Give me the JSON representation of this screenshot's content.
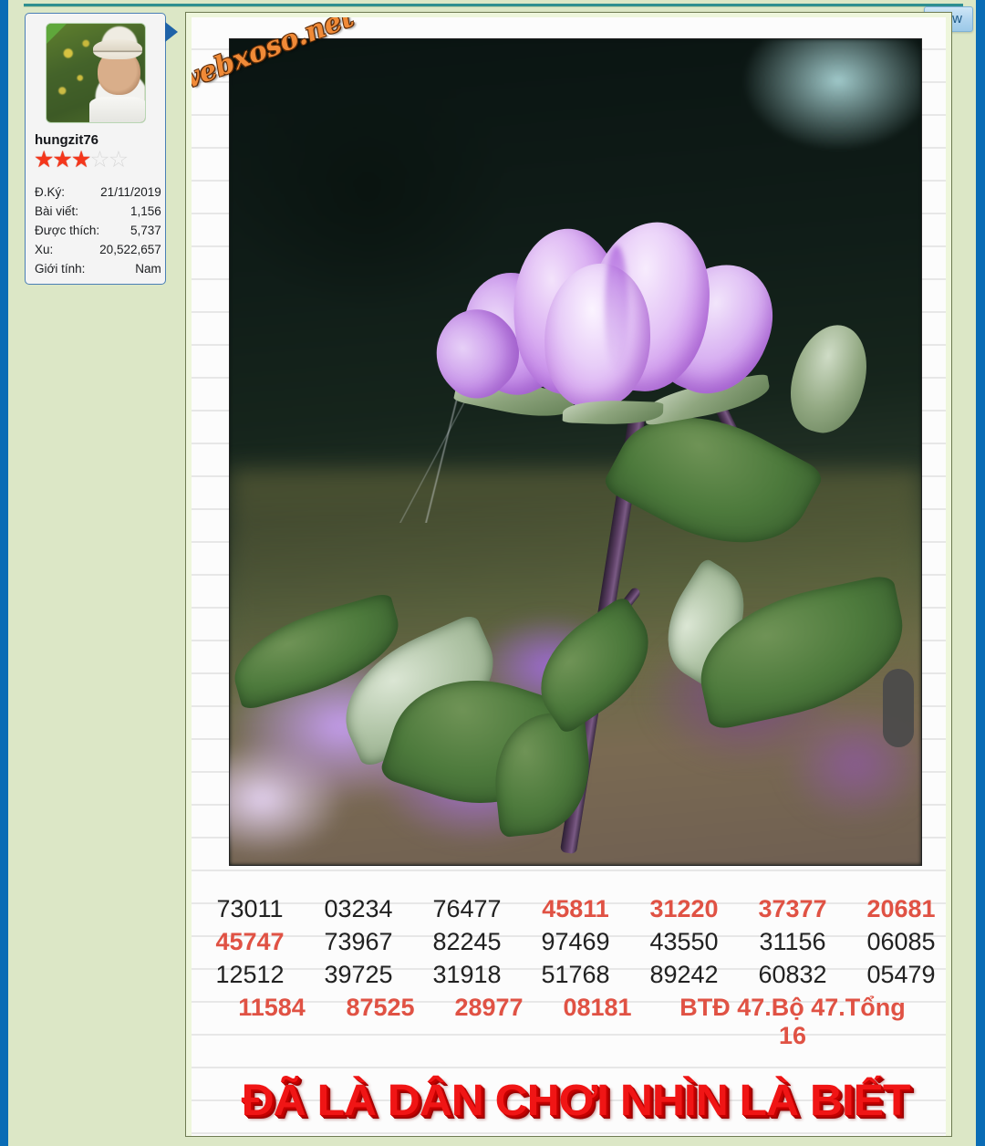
{
  "window": {
    "new_badge_label": "New"
  },
  "user_card": {
    "avatar_alt": "user-avatar-photo",
    "online_indicator": "online-corner",
    "username": "hungzit76",
    "rating": {
      "filled": 3,
      "total": 5
    },
    "stats": [
      {
        "label": "Đ.Ký:",
        "value": "21/11/2019"
      },
      {
        "label": "Bài viết:",
        "value": "1,156"
      },
      {
        "label": "Được thích:",
        "value": "5,737"
      },
      {
        "label": "Xu:",
        "value": "20,522,657"
      },
      {
        "label": "Giới tính:",
        "value": "Nam"
      }
    ]
  },
  "post": {
    "image_watermark": "webxoso.net",
    "image_alt": "purple-rose-photo",
    "number_rows": [
      {
        "cells": [
          {
            "text": "73011",
            "red": false
          },
          {
            "text": "03234",
            "red": false
          },
          {
            "text": "76477",
            "red": false
          },
          {
            "text": "45811",
            "red": true
          },
          {
            "text": "31220",
            "red": true
          },
          {
            "text": "37377",
            "red": true
          },
          {
            "text": "20681",
            "red": true
          }
        ]
      },
      {
        "cells": [
          {
            "text": "45747",
            "red": true
          },
          {
            "text": "73967",
            "red": false
          },
          {
            "text": "82245",
            "red": false
          },
          {
            "text": "97469",
            "red": false
          },
          {
            "text": "43550",
            "red": false
          },
          {
            "text": "31156",
            "red": false
          },
          {
            "text": "06085",
            "red": false
          }
        ]
      },
      {
        "cells": [
          {
            "text": "12512",
            "red": false
          },
          {
            "text": "39725",
            "red": false
          },
          {
            "text": "31918",
            "red": false
          },
          {
            "text": "51768",
            "red": false
          },
          {
            "text": "89242",
            "red": false
          },
          {
            "text": "60832",
            "red": false
          },
          {
            "text": "05479",
            "red": false
          }
        ]
      },
      {
        "cells": [
          {
            "text": "11584",
            "red": true
          },
          {
            "text": "87525",
            "red": true
          },
          {
            "text": "28977",
            "red": true
          },
          {
            "text": "08181",
            "red": true
          },
          {
            "text": "BTĐ 47.Bộ 47.Tổng 16",
            "red": true,
            "wide": true
          }
        ]
      }
    ],
    "banner_text": "ĐÃ LÀ DÂN CHƠI NHÌN LÀ BIẾT"
  },
  "colors": {
    "page_bg": "#dce7c6",
    "edge_blue": "#0a6cb5",
    "accent_red": "#e05244",
    "banner_red": "#f01515",
    "watermark_orange": "#f08a37",
    "star_on": "#f4361b",
    "star_off": "#d9d9d9"
  }
}
